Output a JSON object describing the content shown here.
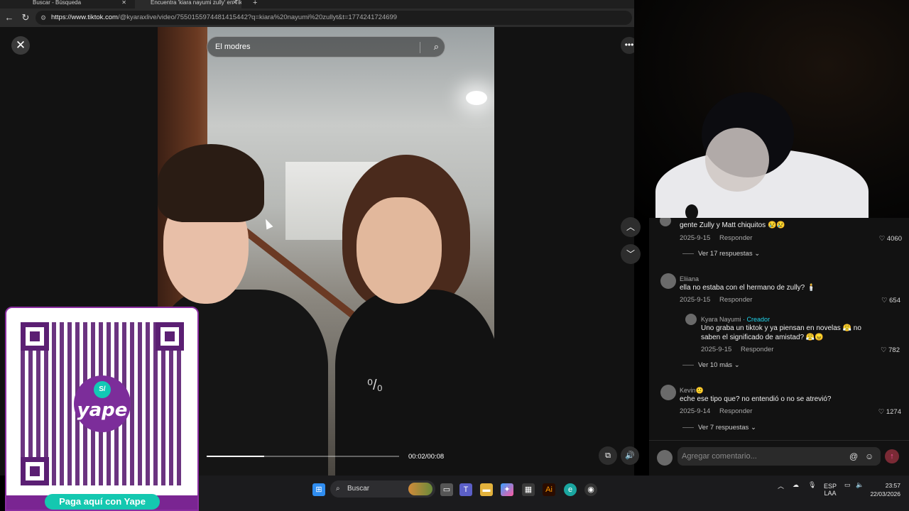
{
  "browser": {
    "tabs": [
      {
        "label": "Buscar - Búsqueda"
      },
      {
        "label": "Encuentra 'kiara nayumi zully' en TikTok"
      }
    ],
    "url_host": "https://www.tiktok.com",
    "url_path": "/@kyaraxlive/video/7550155974481415442?q=kiara%20nayumi%20zullyt&t=1774241724699"
  },
  "viewer": {
    "search_value": "El modres",
    "timecode": "00:02/00:08",
    "progress": 0.3
  },
  "comments": [
    {
      "user": "",
      "text": "gente Zully y Matt chiquitos 😢😢",
      "date": "2025-9-15",
      "reply_label": "Responder",
      "likes": "4060",
      "view_more": "Ver 17 respuestas"
    },
    {
      "user": "Eliiana",
      "text": "ella no estaba con el hermano de zully? 🕯️",
      "date": "2025-9-15",
      "reply_label": "Responder",
      "likes": "654"
    },
    {
      "user": "Kyara Nayumi",
      "creator_tag": "· Creador",
      "text_line1": "Uno graba un tiktok y ya piensan en novelas 😤 no",
      "text_line2": "saben el significado de amistad? 😤😠",
      "date": "2025-9-15",
      "reply_label": "Responder",
      "likes": "782",
      "view_more": "Ver 10 más"
    },
    {
      "user": "Kevin🙂",
      "text": "eche ese tipo que? no entendió o no se atrevió?",
      "date": "2025-9-14",
      "reply_label": "Responder",
      "likes": "1274",
      "view_more": "Ver 7 respuestas"
    }
  ],
  "add_comment": {
    "placeholder": "Agregar comentario..."
  },
  "yape": {
    "coin": "S/",
    "word": "yape",
    "cta": "Paga aquí con Yape"
  },
  "taskbar": {
    "search_label": "Buscar",
    "lang": "ESP",
    "lang2": "LAA",
    "time": "23:57",
    "date": "22/03/2026"
  },
  "icons": {
    "close": "close-icon",
    "search": "search-icon",
    "more": "more-icon",
    "up": "chevron-up-icon",
    "down": "chevron-down-icon",
    "mute": "volume-icon",
    "pip": "picture-in-picture-icon",
    "heart": "heart-icon",
    "mention": "mention-icon",
    "emoji": "emoji-icon",
    "send": "send-icon"
  },
  "colors": {
    "creator": "#20d5ec",
    "yape_purple": "#7a2592",
    "yape_teal": "#14c8b0"
  }
}
